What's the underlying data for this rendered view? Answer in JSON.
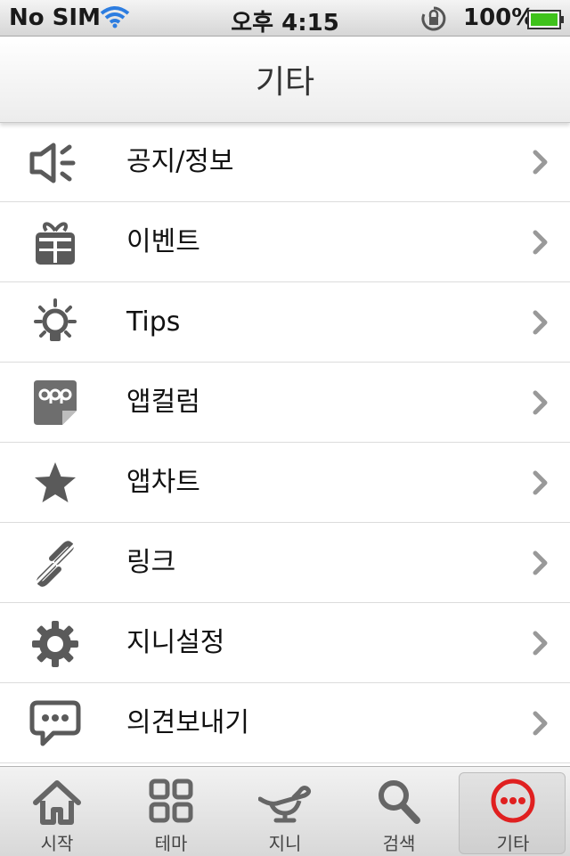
{
  "status": {
    "carrier": "No SIM",
    "time": "오후 4:15",
    "battery": "100%",
    "icons": [
      "wifi-icon",
      "rotation-lock-icon",
      "battery-icon"
    ]
  },
  "nav": {
    "title": "기타"
  },
  "menu": [
    {
      "label": "공지/정보",
      "icon": "megaphone-icon"
    },
    {
      "label": "이벤트",
      "icon": "gift-icon"
    },
    {
      "label": "Tips",
      "icon": "lightbulb-icon"
    },
    {
      "label": "앱컬럼",
      "icon": "app-column-icon"
    },
    {
      "label": "앱차트",
      "icon": "star-icon"
    },
    {
      "label": "링크",
      "icon": "link-icon"
    },
    {
      "label": "지니설정",
      "icon": "gear-icon"
    },
    {
      "label": "의견보내기",
      "icon": "speech-bubble-icon"
    }
  ],
  "tabs": [
    {
      "label": "시작",
      "icon": "home-icon"
    },
    {
      "label": "테마",
      "icon": "grid-icon"
    },
    {
      "label": "지니",
      "icon": "genie-lamp-icon"
    },
    {
      "label": "검색",
      "icon": "search-icon"
    },
    {
      "label": "기타",
      "icon": "more-icon",
      "active": true
    }
  ],
  "colors": {
    "active_tab": "#e02020",
    "icon_gray": "#6b6b6b",
    "battery_green": "#3fc21b"
  }
}
